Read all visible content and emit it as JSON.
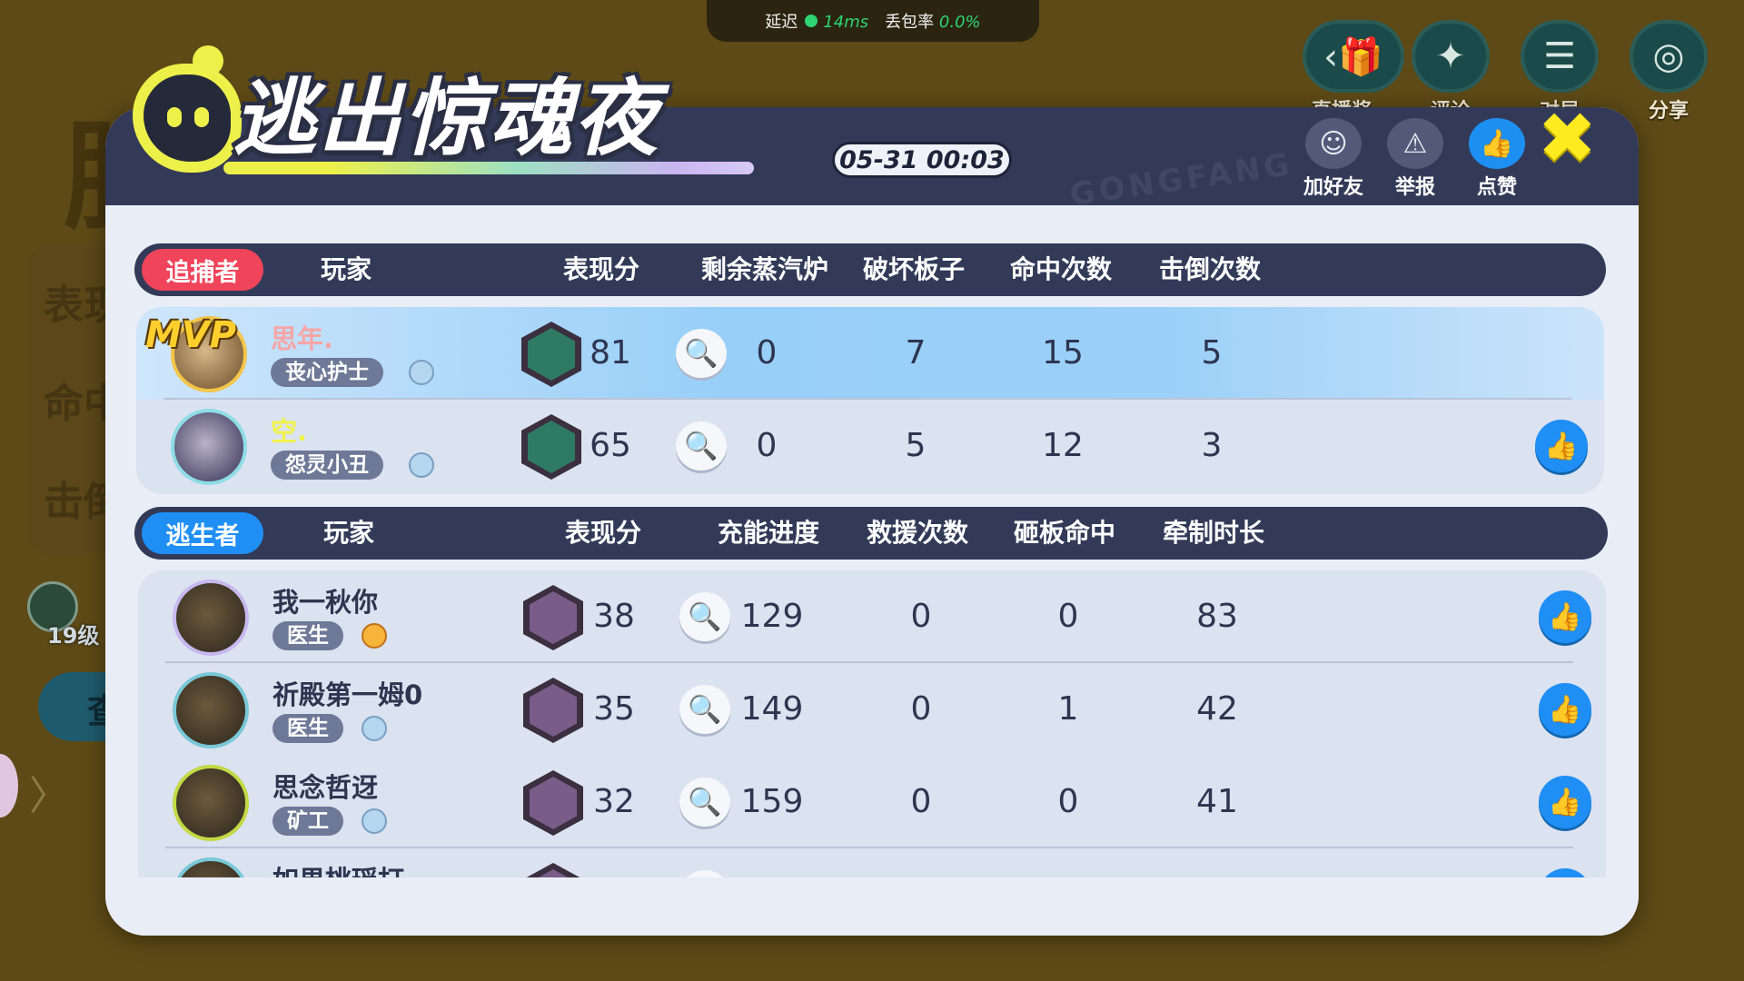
{
  "status": {
    "delay_label": "延迟",
    "delay_value": "14ms",
    "loss_label": "丢包率",
    "loss_value": "0.0%"
  },
  "top_icons": [
    {
      "icon": "gift-icon",
      "label": "直播奖励"
    },
    {
      "icon": "star-icon",
      "label": "评论"
    },
    {
      "icon": "list-icon",
      "label": "对局"
    },
    {
      "icon": "camera-icon",
      "label": "分享"
    }
  ],
  "background": {
    "big_letter": "胜",
    "side_labels": [
      "表现",
      "命中",
      "击倒"
    ],
    "level": "19级",
    "button": "查"
  },
  "title": "逃出惊魂夜",
  "timestamp": "05-31 00:03",
  "head_actions": {
    "add_friend": "加好友",
    "report": "举报",
    "like": "点赞"
  },
  "hunters": {
    "role": "追捕者",
    "headers": [
      "玩家",
      "表现分",
      "剩余蒸汽炉",
      "破坏板子",
      "命中次数",
      "击倒次数"
    ],
    "rows": [
      {
        "mvp": "MVP",
        "name": "思年.",
        "character": "丧心护士",
        "score": "81",
        "c1": "0",
        "c2": "7",
        "c3": "15",
        "c4": "5"
      },
      {
        "name": "空.",
        "character": "怨灵小丑",
        "score": "65",
        "c1": "0",
        "c2": "5",
        "c3": "12",
        "c4": "3"
      }
    ]
  },
  "survivors": {
    "role": "逃生者",
    "headers": [
      "玩家",
      "表现分",
      "充能进度",
      "救援次数",
      "砸板命中",
      "牵制时长"
    ],
    "rows": [
      {
        "name": "我一秋你",
        "character": "医生",
        "score": "38",
        "c1": "129",
        "c2": "0",
        "c3": "0",
        "c4": "83"
      },
      {
        "name": "祈殿第一姆0",
        "character": "医生",
        "score": "35",
        "c1": "149",
        "c2": "0",
        "c3": "1",
        "c4": "42"
      },
      {
        "name": "思念哲迓",
        "character": "矿工",
        "score": "32",
        "c1": "159",
        "c2": "0",
        "c3": "0",
        "c4": "41"
      },
      {
        "name": "如果桃瑶打"
      }
    ]
  }
}
